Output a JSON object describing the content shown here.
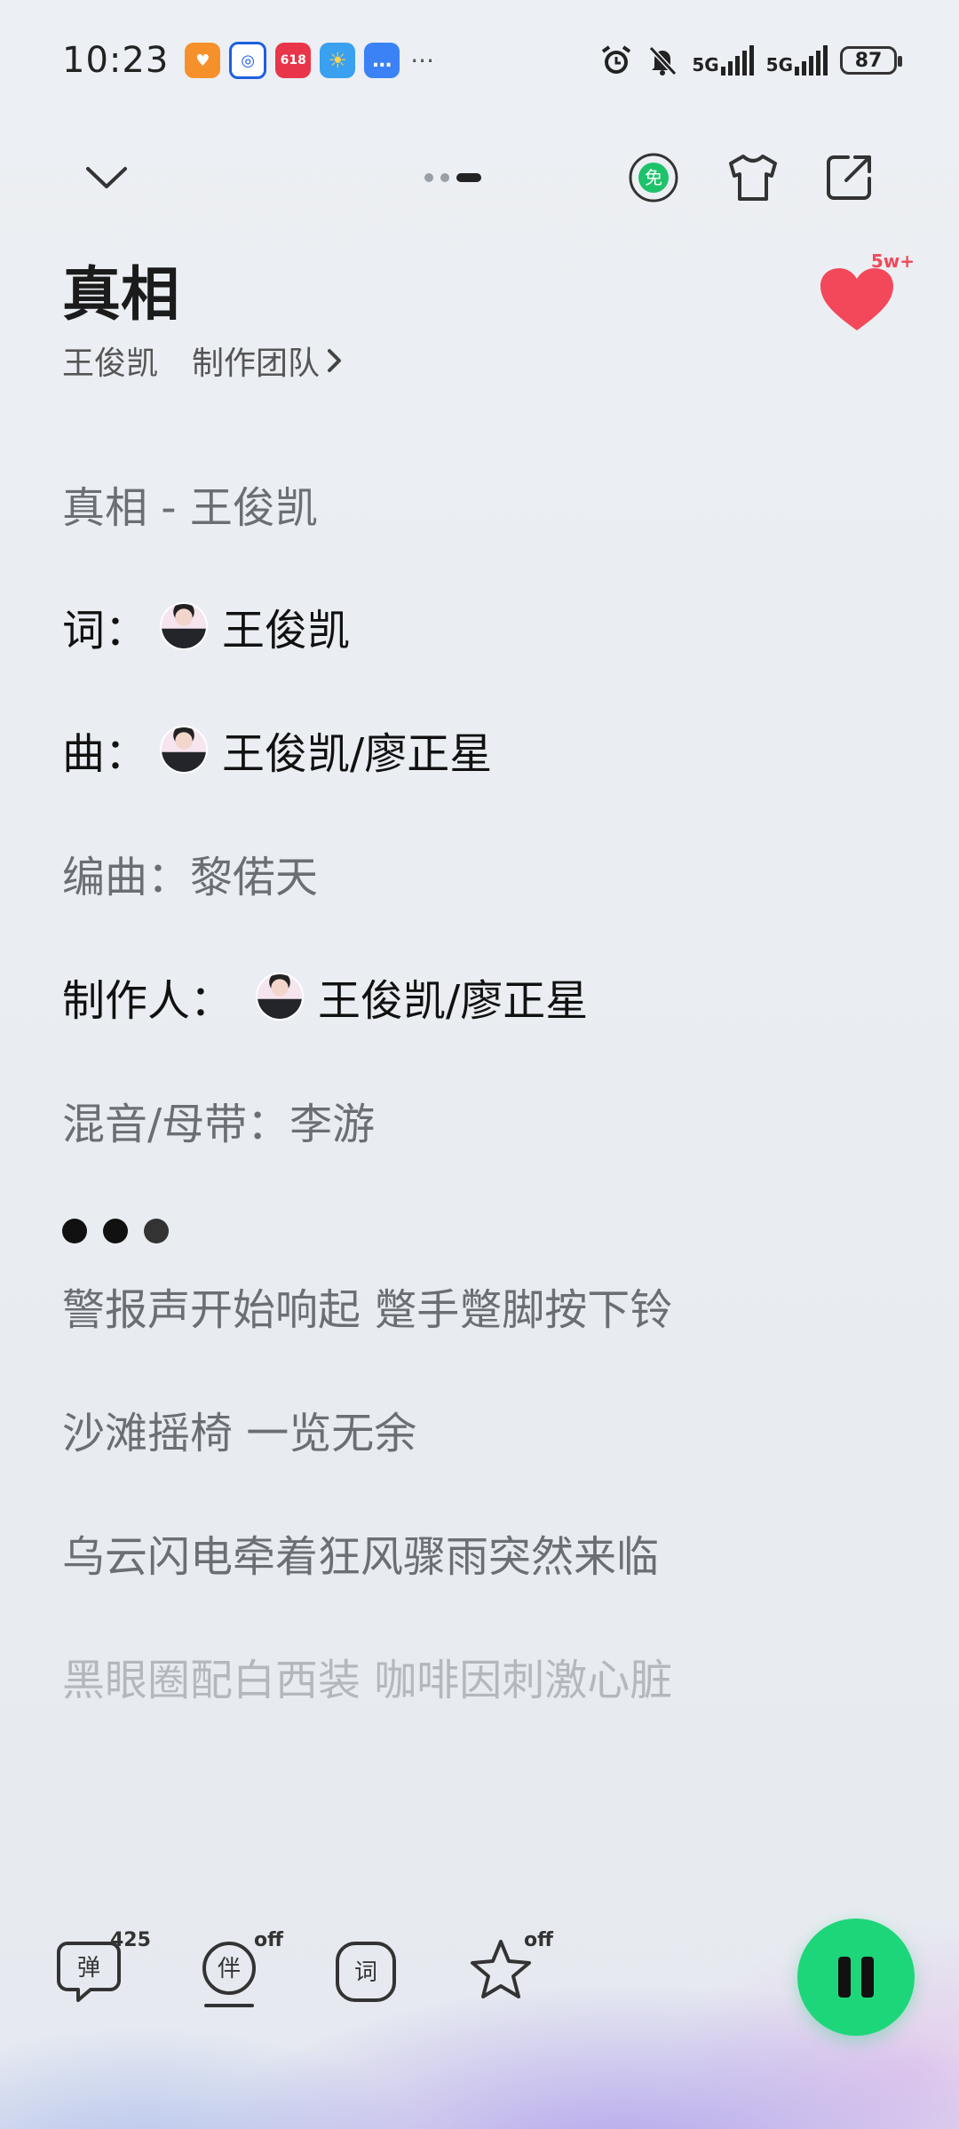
{
  "status_bar": {
    "time": "10:23",
    "notifications": [
      {
        "name": "app-notif-orange-icon",
        "color": "#f6902a",
        "glyph": "♥"
      },
      {
        "name": "app-notif-blue-icon",
        "color": "#1e5fe0",
        "glyph": "◎"
      },
      {
        "name": "app-notif-618-icon",
        "color": "#e8354a",
        "glyph": "618"
      },
      {
        "name": "app-notif-weather-icon",
        "color": "#3aa0f0",
        "glyph": "☀"
      },
      {
        "name": "app-notif-message-icon",
        "color": "#3b82f6",
        "glyph": "…"
      }
    ],
    "more": "···",
    "network1": "5G",
    "network2": "5G",
    "battery": "87"
  },
  "song": {
    "title": "真相",
    "artist": "王俊凯",
    "team_link": "制作团队",
    "like_count": "5w+"
  },
  "lyrics": [
    {
      "text": "真相 - 王俊凯",
      "style": "gray"
    },
    {
      "label": "词：",
      "value": "王俊凯",
      "style": "black",
      "avatar": true
    },
    {
      "label": "曲：",
      "value": "王俊凯/廖正星",
      "style": "black",
      "avatar": true
    },
    {
      "text": "编曲：黎偌天",
      "style": "gray"
    },
    {
      "label": "制作人：",
      "value": "王俊凯/廖正星",
      "style": "black",
      "avatar": true
    },
    {
      "text": "混音/母带：李游",
      "style": "gray"
    },
    {
      "dots": true
    },
    {
      "text": "警报声开始响起 蹩手蹩脚按下铃",
      "style": "gray"
    },
    {
      "text": "沙滩摇椅 一览无余",
      "style": "gray"
    },
    {
      "text": "乌云闪电牵着狂风骤雨突然来临",
      "style": "gray"
    },
    {
      "text": "黑眼圈配白西装 咖啡因刺激心脏",
      "style": "faded"
    }
  ],
  "bottom_bar": {
    "danmaku_label": "弹",
    "danmaku_count": "425",
    "accompany_label": "伴",
    "accompany_state": "off",
    "lyric_label": "词",
    "star_state": "off"
  },
  "colors": {
    "accent_green": "#1ed67a",
    "like_red": "#f2485a",
    "free_badge_green": "#1ec26b"
  }
}
